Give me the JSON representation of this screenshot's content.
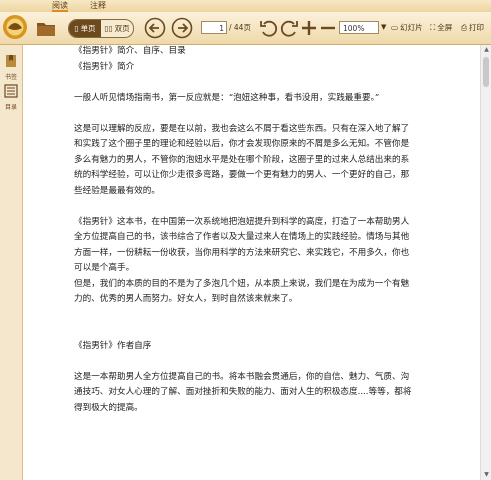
{
  "menu": {
    "tabs": [
      {
        "label": "阅读"
      },
      {
        "label": "注释"
      }
    ]
  },
  "toolbar": {
    "single_page": "单页",
    "double_page": "双页",
    "page_current": "1",
    "page_total": "/ 44页",
    "zoom_value": "100%",
    "slideshow": "幻灯片",
    "fullscreen": "全屏",
    "print": "打印"
  },
  "sidebar": {
    "items": [
      {
        "label": "书签"
      },
      {
        "label": "目录"
      }
    ]
  },
  "document": {
    "paragraphs": [
      "《指男针》简介、自序、目录",
      "《指男针》简介",
      "",
      "一般人听见情场指南书，第一反应就是：“泡妞这种事，看书没用，实践最重要。”",
      "",
      "这是可以理解的反应，要是在以前，我也会这么不屑于看这些东西。只有在深入地了解了和实践了这个圈子里的理论和经验以后，你才会发现你原来的不屑是多么无知。不管你是多么有魅力的男人，不管你的泡妞水平是处在哪个阶段，这圈子里的过来人总结出来的系统的科学经验，可以让你少走很多弯路，要做一个更有魅力的男人、一个更好的自己，那些经验是最最有效的。",
      "",
      "《指男针》这本书，在中国第一次系统地把泡妞提升到科学的高度，打造了一本帮助男人全方位提高自己的书，该书综合了作者以及大量过来人在情场上的实践经验。情场与其他方面一样，一份耕耘一份收获，当你用科学的方法来研究它、来实践它，不用多久，你也可以是个高手。",
      "但是，我们的本质的目的不是为了多泡几个妞，从本质上来说，我们是在为成为一个有魅力的、优秀的男人而努力。好女人，到时自然该来就来了。",
      "",
      "",
      "《指男针》作者自序",
      "",
      "这是一本帮助男人全方位提高自己的书。将本书融会贯通后，你的自信、魅力、气质、沟通技巧、对女人心理的了解、面对挫折和失败的能力、面对人生的积极态度....等等，都将得到极大的提高。"
    ]
  }
}
